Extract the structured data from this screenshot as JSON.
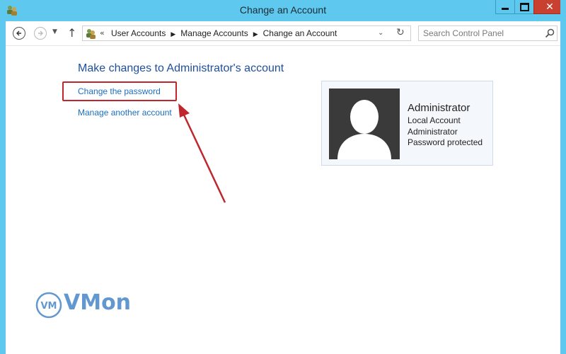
{
  "window": {
    "title": "Change an Account",
    "close_glyph": "✕"
  },
  "nav": {
    "breadcrumb_chevron": "«",
    "breadcrumbs": [
      "User Accounts",
      "Manage Accounts",
      "Change an Account"
    ],
    "search_placeholder": "Search Control Panel"
  },
  "main": {
    "heading": "Make changes to Administrator's account",
    "links": {
      "change_password": "Change the password",
      "manage_other": "Manage another account"
    },
    "highlight_color": "#c0262d"
  },
  "account": {
    "name": "Administrator",
    "type": "Local Account",
    "role": "Administrator",
    "status": "Password protected"
  },
  "watermark": {
    "logo_text": "VMon",
    "badge": "VM"
  },
  "colors": {
    "frame": "#5ec8ee",
    "link": "#1a6fc4",
    "heading": "#1e4f9c",
    "close_button": "#c84030"
  }
}
